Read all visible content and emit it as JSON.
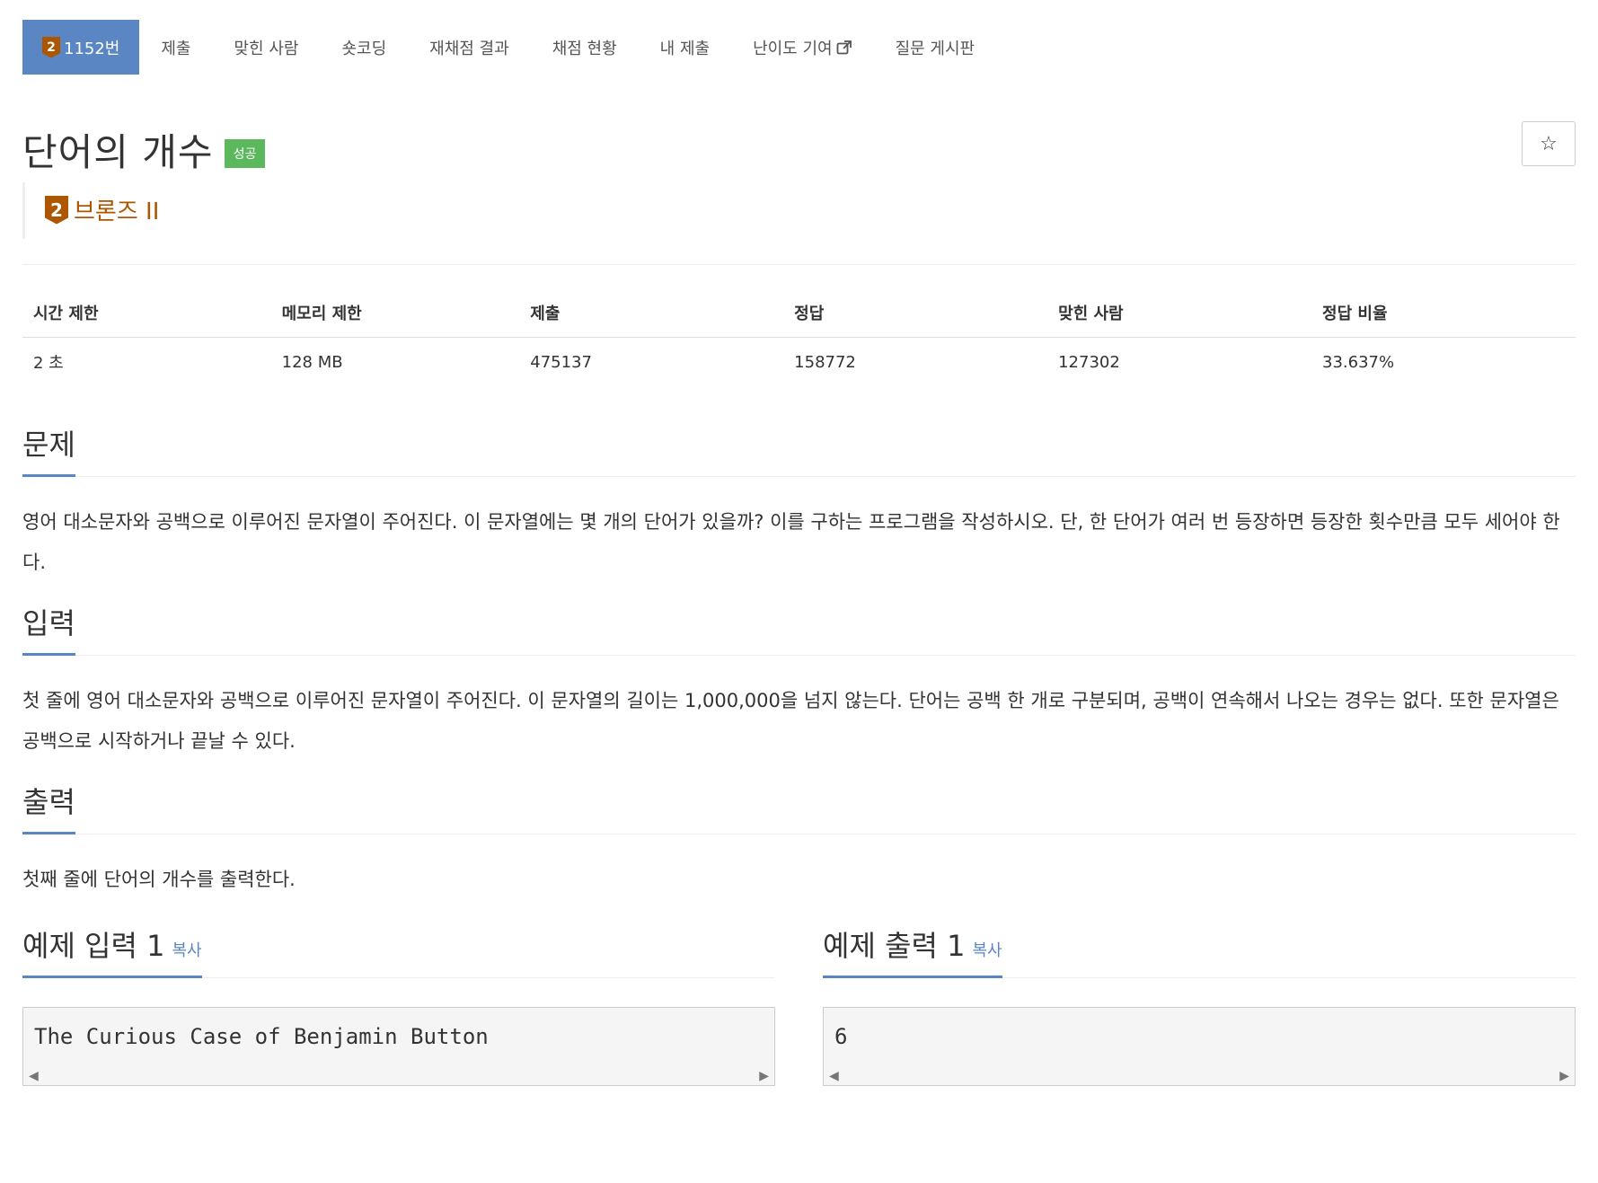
{
  "nav": {
    "problem_number": "1152번",
    "tier_digit": "2",
    "items": [
      {
        "label": "제출"
      },
      {
        "label": "맞힌 사람"
      },
      {
        "label": "숏코딩"
      },
      {
        "label": "재채점 결과"
      },
      {
        "label": "채점 현황"
      },
      {
        "label": "내 제출"
      },
      {
        "label": "난이도 기여"
      },
      {
        "label": "질문 게시판"
      }
    ]
  },
  "problem": {
    "title": "단어의 개수",
    "result_badge": "성공",
    "tier_digit": "2",
    "tier_label": "브론즈 II",
    "star_icon": "☆"
  },
  "info": {
    "headers": [
      "시간 제한",
      "메모리 제한",
      "제출",
      "정답",
      "맞힌 사람",
      "정답 비율"
    ],
    "values": [
      "2 초",
      "128 MB",
      "475137",
      "158772",
      "127302",
      "33.637%"
    ]
  },
  "sections": {
    "problem_heading": "문제",
    "problem_text": "영어 대소문자와 공백으로 이루어진 문자열이 주어진다. 이 문자열에는 몇 개의 단어가 있을까? 이를 구하는 프로그램을 작성하시오. 단, 한 단어가 여러 번 등장하면 등장한 횟수만큼 모두 세어야 한다.",
    "input_heading": "입력",
    "input_text": "첫 줄에 영어 대소문자와 공백으로 이루어진 문자열이 주어진다. 이 문자열의 길이는 1,000,000을 넘지 않는다. 단어는 공백 한 개로 구분되며, 공백이 연속해서 나오는 경우는 없다. 또한 문자열은 공백으로 시작하거나 끝날 수 있다.",
    "output_heading": "출력",
    "output_text": "첫째 줄에 단어의 개수를 출력한다."
  },
  "samples": {
    "input_heading": "예제 입력 1",
    "output_heading": "예제 출력 1",
    "copy_label": "복사",
    "input_value": "The Curious Case of Benjamin Button",
    "output_value": "6"
  }
}
